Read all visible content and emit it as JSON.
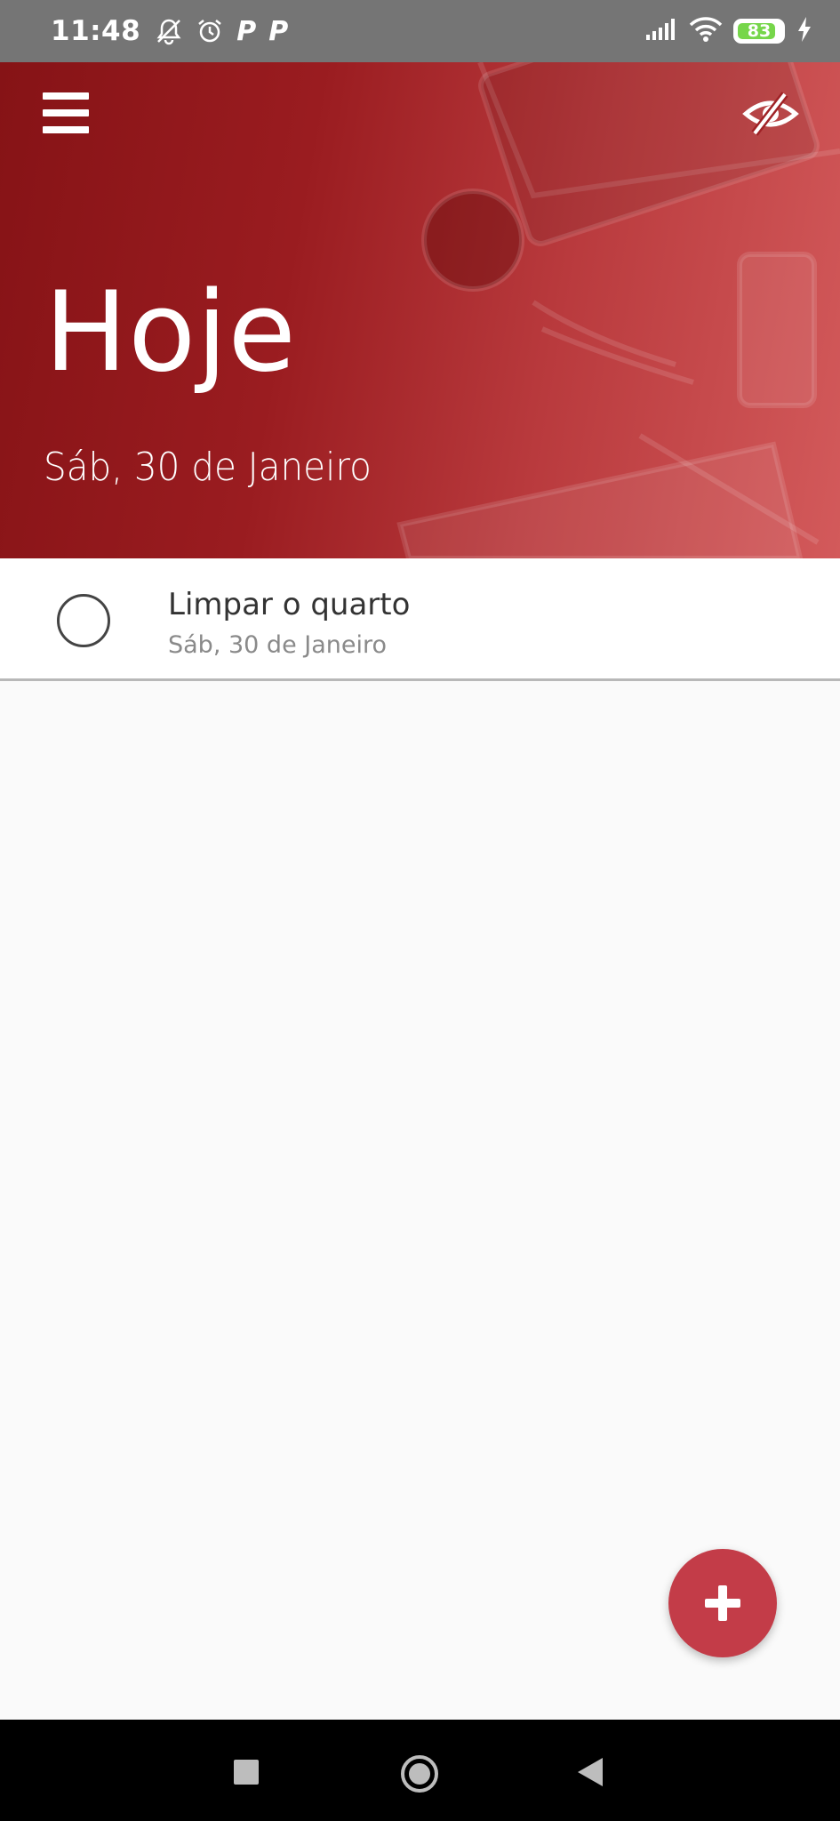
{
  "status_bar": {
    "time": "11:48",
    "notification_icons": [
      "bell-off-icon",
      "alarm-icon",
      "p-app-icon",
      "p-app-icon"
    ],
    "p_glyph": "P",
    "battery_level": "83",
    "icons_right": [
      "signal-icon",
      "wifi-icon",
      "battery-icon",
      "charging-icon"
    ]
  },
  "header": {
    "menu_icon": "hamburger-menu-icon",
    "visibility_icon": "eye-off-icon",
    "title": "Hoje",
    "date": "Sáb, 30 de Janeiro",
    "theme_color": "#9a1c20"
  },
  "tasks": [
    {
      "name": "Limpar o quarto",
      "date": "Sáb, 30 de Janeiro",
      "completed": false
    }
  ],
  "fab": {
    "icon": "plus-icon",
    "color": "#c33c48"
  },
  "nav_bar": {
    "buttons": [
      "recent-apps",
      "home",
      "back"
    ]
  }
}
